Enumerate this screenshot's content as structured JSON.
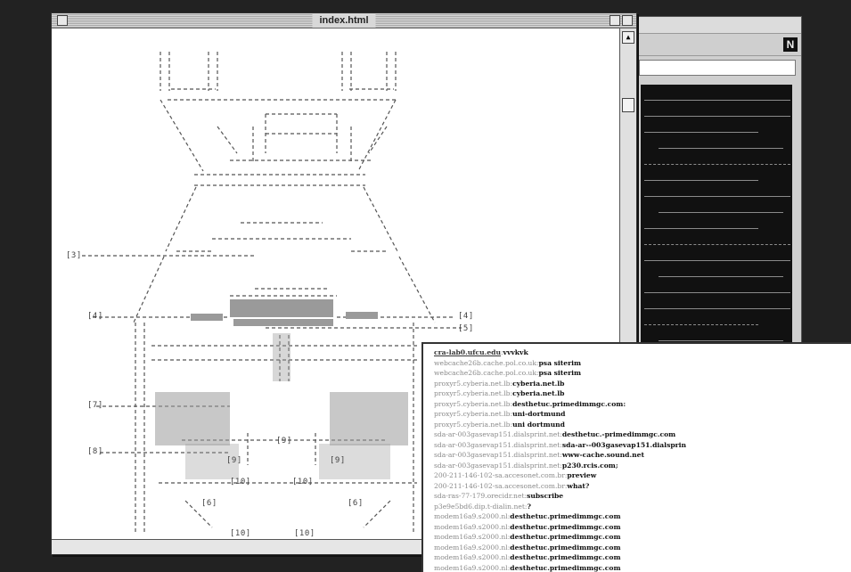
{
  "main_window": {
    "title": "index.html"
  },
  "back_window": {
    "logo": "N"
  },
  "ascii_labels": [
    {
      "text": "[3]"
    },
    {
      "text": "[4]"
    },
    {
      "text": "[4]"
    },
    {
      "text": "[5]"
    },
    {
      "text": "[7]"
    },
    {
      "text": "[8]"
    },
    {
      "text": "[9]"
    },
    {
      "text": "[9]"
    },
    {
      "text": "[9]"
    },
    {
      "text": "[10]"
    },
    {
      "text": "[10]"
    },
    {
      "text": "[6]"
    },
    {
      "text": "[6]"
    },
    {
      "text": "[10]"
    },
    {
      "text": "[10]"
    }
  ],
  "host_list": [
    {
      "host": "cra-lab0.ufcu.edu",
      "target": "vvvkvk"
    },
    {
      "host": "webcache26b.cache.pol.co.uk",
      "target": "psa siterim"
    },
    {
      "host": "webcache26b.cache.pol.co.uk",
      "target": "psa siterim"
    },
    {
      "host": "proxyr5.cyberia.net.lb",
      "target": "cyberia.net.lb"
    },
    {
      "host": "proxyr5.cyberia.net.lb",
      "target": "cyberia.net.lb"
    },
    {
      "host": "proxyr5.cyberia.net.lb",
      "target": "desthetuc.primedimmgc.com:"
    },
    {
      "host": "proxyr5.cyberia.net.lb",
      "target": "uni-dortmund"
    },
    {
      "host": "proxyr5.cyberia.net.lb",
      "target": "uni dortmund"
    },
    {
      "host": "sda-ar-003gasevap151.dialsprint.net",
      "target": "desthetuc.-primedimmgc.com"
    },
    {
      "host": "sda-ar-003gasevap151.dialsprint.net",
      "target": "sda-ar--003gasevap151.dialsprin"
    },
    {
      "host": "sda-ar-003gasevap151.dialsprint.net",
      "target": "www-cache.sound.net"
    },
    {
      "host": "sda-ar-003gasevap151.dialsprint.net",
      "target": "p230.rcis.com;"
    },
    {
      "host": "200-211-146-102-sa.accesonet.com.br",
      "target": "preview"
    },
    {
      "host": "200-211-146-102-sa.accesonet.com.br",
      "target": "what?"
    },
    {
      "host": "sda-ras-77-179.orecidr.net",
      "target": "subscribe"
    },
    {
      "host": "p3e9e5bd6.dip.t-dialin.net",
      "target": "?"
    },
    {
      "host": "modem16a9.s2000.nl",
      "target": "desthetuc.primedimmgc.com"
    },
    {
      "host": "modem16a9.s2000.nl",
      "target": "desthetuc.primedimmgc.com"
    },
    {
      "host": "modem16a9.s2000.nl",
      "target": "desthetuc.primedimmgc.com"
    },
    {
      "host": "modem16a9.s2000.nl",
      "target": "desthetuc.primedimmgc.com"
    },
    {
      "host": "modem16a9.s2000.nl",
      "target": "desthetuc.primedimmgc.com"
    },
    {
      "host": "modem16a9.s2000.nl",
      "target": "desthetuc.primedimmgc.com"
    }
  ]
}
